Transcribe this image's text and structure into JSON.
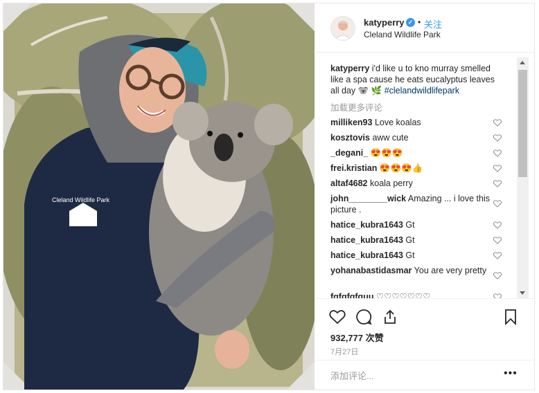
{
  "post": {
    "username": "katyperry",
    "follow_label": "关注",
    "dot": "•",
    "location": "Cleland Wildlife Park",
    "photo_logo_text": "Cleland Wildlife Park"
  },
  "caption": {
    "username": "katyperry",
    "text": "i'd like u to kno murray smelled like a spa cause he eats eucalyptus leaves all day 🐨 🌿 ",
    "hashtag": "#clelandwildlifepark"
  },
  "load_more": "加载更多评论",
  "comments": [
    {
      "user": "milliken93",
      "text": "Love koalas"
    },
    {
      "user": "kosztovis",
      "text": "aww cute"
    },
    {
      "user": "_degani_",
      "text": "😍😍😍"
    },
    {
      "user": "frei.kristian",
      "text": "😍😍😍👍"
    },
    {
      "user": "altaf4682",
      "text": "koala perry"
    },
    {
      "user": "john________wick",
      "text": "Amazing ... i love this picture ."
    },
    {
      "user": "hatice_kubra1643",
      "text": "Gt"
    },
    {
      "user": "hatice_kubra1643",
      "text": "Gt"
    },
    {
      "user": "hatice_kubra1643",
      "text": "Gt"
    },
    {
      "user": "yohanabastidasmar",
      "text": "You are very pretty"
    },
    {
      "user": "fqfqfqfquu",
      "text": "♡♡♡♡♡♡♡"
    }
  ],
  "actions": {
    "likes": "932,777 次赞",
    "date": "7月27日",
    "add_comment_placeholder": "添加评论...",
    "more": "•••"
  },
  "colors": {
    "accent": "#3897f0",
    "text": "#262626",
    "muted": "#999999",
    "border": "#efefef"
  }
}
